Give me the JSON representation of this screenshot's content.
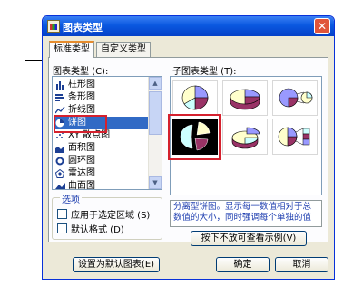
{
  "window": {
    "title": "图表类型",
    "close_label": "✕"
  },
  "tabs": [
    {
      "label": "标准类型"
    },
    {
      "label": "自定义类型"
    }
  ],
  "chart_type_list": {
    "label": "图表类型 (C):",
    "items": [
      {
        "label": "柱形图",
        "icon": "column-chart-icon"
      },
      {
        "label": "条形图",
        "icon": "bar-chart-icon"
      },
      {
        "label": "折线图",
        "icon": "line-chart-icon"
      },
      {
        "label": "饼图",
        "icon": "pie-chart-icon",
        "selected": true
      },
      {
        "label": "XY 散点图",
        "icon": "scatter-chart-icon"
      },
      {
        "label": "面积图",
        "icon": "area-chart-icon"
      },
      {
        "label": "圆环图",
        "icon": "doughnut-chart-icon"
      },
      {
        "label": "雷达图",
        "icon": "radar-chart-icon"
      },
      {
        "label": "曲面图",
        "icon": "surface-chart-icon"
      }
    ]
  },
  "subtype": {
    "label": "子图表类型 (T):",
    "selected_index": 3,
    "items": [
      {
        "name": "pie"
      },
      {
        "name": "3d-pie"
      },
      {
        "name": "pie-of-pie"
      },
      {
        "name": "exploded-pie"
      },
      {
        "name": "3d-exploded-pie"
      },
      {
        "name": "bar-of-pie"
      }
    ]
  },
  "options": {
    "label": "选项",
    "apply_to_selection": {
      "label": "应用于选定区域 (S)",
      "checked": false
    },
    "default_format": {
      "label": "默认格式 (D)",
      "checked": false
    }
  },
  "description": "分离型饼图。显示每一数值相对于总数值的大小，同时强调每个单独的值",
  "preview_button": "按下不放可查看示例(V)",
  "buttons": {
    "set_default": "设置为默认图表(E)",
    "ok": "确定",
    "cancel": "取消"
  },
  "colors": {
    "pie_a": "#9999ff",
    "pie_b": "#993366",
    "pie_c": "#ffffcc",
    "pie_d": "#ccffff",
    "title_bar": "#0a58e0",
    "highlight": "#d5212e"
  }
}
